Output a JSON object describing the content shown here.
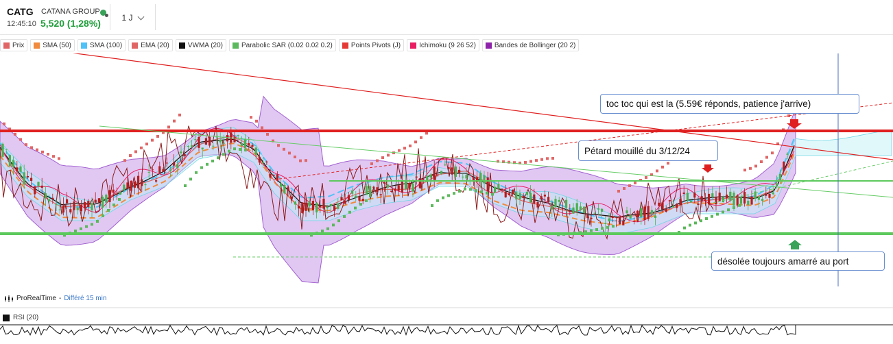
{
  "header": {
    "ticker": "CATG",
    "company": "CATANA GROUP",
    "time": "12:45:10",
    "price": "5,520 (1,28%)",
    "timeframe": "1 J",
    "status_icon": "market-status-dot-icon"
  },
  "legend": [
    {
      "label": "Prix",
      "color": "#e06666"
    },
    {
      "label": "SMA (50)",
      "color": "#f08a3c"
    },
    {
      "label": "SMA (100)",
      "color": "#4fc3f7"
    },
    {
      "label": "EMA (20)",
      "color": "#e06666"
    },
    {
      "label": "VWMA (20)",
      "color": "#111111"
    },
    {
      "label": "Parabolic SAR (0.02 0.02 0.2)",
      "color": "#5cb85c"
    },
    {
      "label": "Points Pivots (J)",
      "color": "#e53935"
    },
    {
      "label": "Ichimoku (9 26 52)",
      "color": "#e91e63"
    },
    {
      "label": "Bandes de Bollinger (20 2)",
      "color": "#8e24aa"
    }
  ],
  "annotations": {
    "toc": "toc toc qui est la (5.59€ réponds, patience j'arrive)",
    "petard": "Pétard mouillé du 3/12/24",
    "desolee": "désolée toujours amarré au port"
  },
  "footer": {
    "provider": "ProRealTime",
    "separator": "-",
    "delay": "Différé 15 min",
    "rsi_label": "RSI (20)"
  },
  "colors": {
    "up": "#4caf50",
    "down": "#b71c1c",
    "bollinger_fill": "#c79be8",
    "resistance": "#e02020",
    "support": "#5cc95c",
    "accent_blue": "#4a6fc0"
  }
}
